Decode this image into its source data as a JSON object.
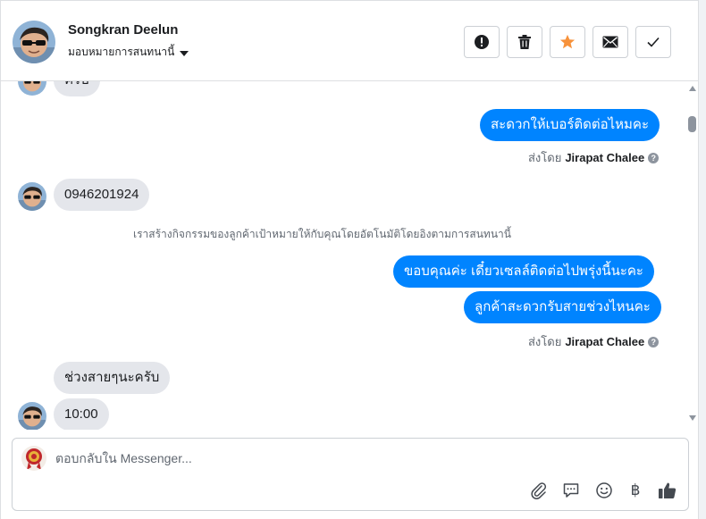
{
  "contact": {
    "name": "Songkran Deelun",
    "assign_label": "มอบหมายการสนทนานี้"
  },
  "toolbar": {
    "buttons": [
      {
        "name": "spam-button",
        "icon": "alert-icon"
      },
      {
        "name": "delete-button",
        "icon": "trash-icon"
      },
      {
        "name": "star-button",
        "icon": "star-icon"
      },
      {
        "name": "mark-unread-button",
        "icon": "envelope-icon"
      },
      {
        "name": "mark-done-button",
        "icon": "check-icon"
      }
    ]
  },
  "messages": {
    "partial_top": "ครับ",
    "out1": "สะดวกให้เบอร์ติดต่อไหมคะ",
    "sent_by_prefix": "ส่งโดย",
    "sent_by_name": "Jirapat Chalee",
    "help_mark": "?",
    "in_phone": "0946201924",
    "system_note": "เราสร้างกิจกรรมของลูกค้าเป้าหมายให้กับคุณโดยอัตโนมัติโดยอิงตามการสนทนานี้",
    "out2": "ขอบคุณค่ะ  เดี๋ยวเซลล์ติดต่อไปพรุ่งนี้นะคะ",
    "out3": "ลูกค้าสะดวกรับสายช่วงไหนคะ",
    "sent_by_prefix_2": "ส่งโดย",
    "sent_by_name_2": "Jirapat Chalee",
    "in_time_label": "ช่วงสายๆนะครับ",
    "in_time": "10:00"
  },
  "composer": {
    "placeholder": "ตอบกลับใน Messenger...",
    "value": "",
    "currency_symbol": "฿"
  },
  "colors": {
    "outgoing_bubble": "#0084ff",
    "incoming_bubble": "#e4e6eb",
    "star": "#f7923b"
  }
}
